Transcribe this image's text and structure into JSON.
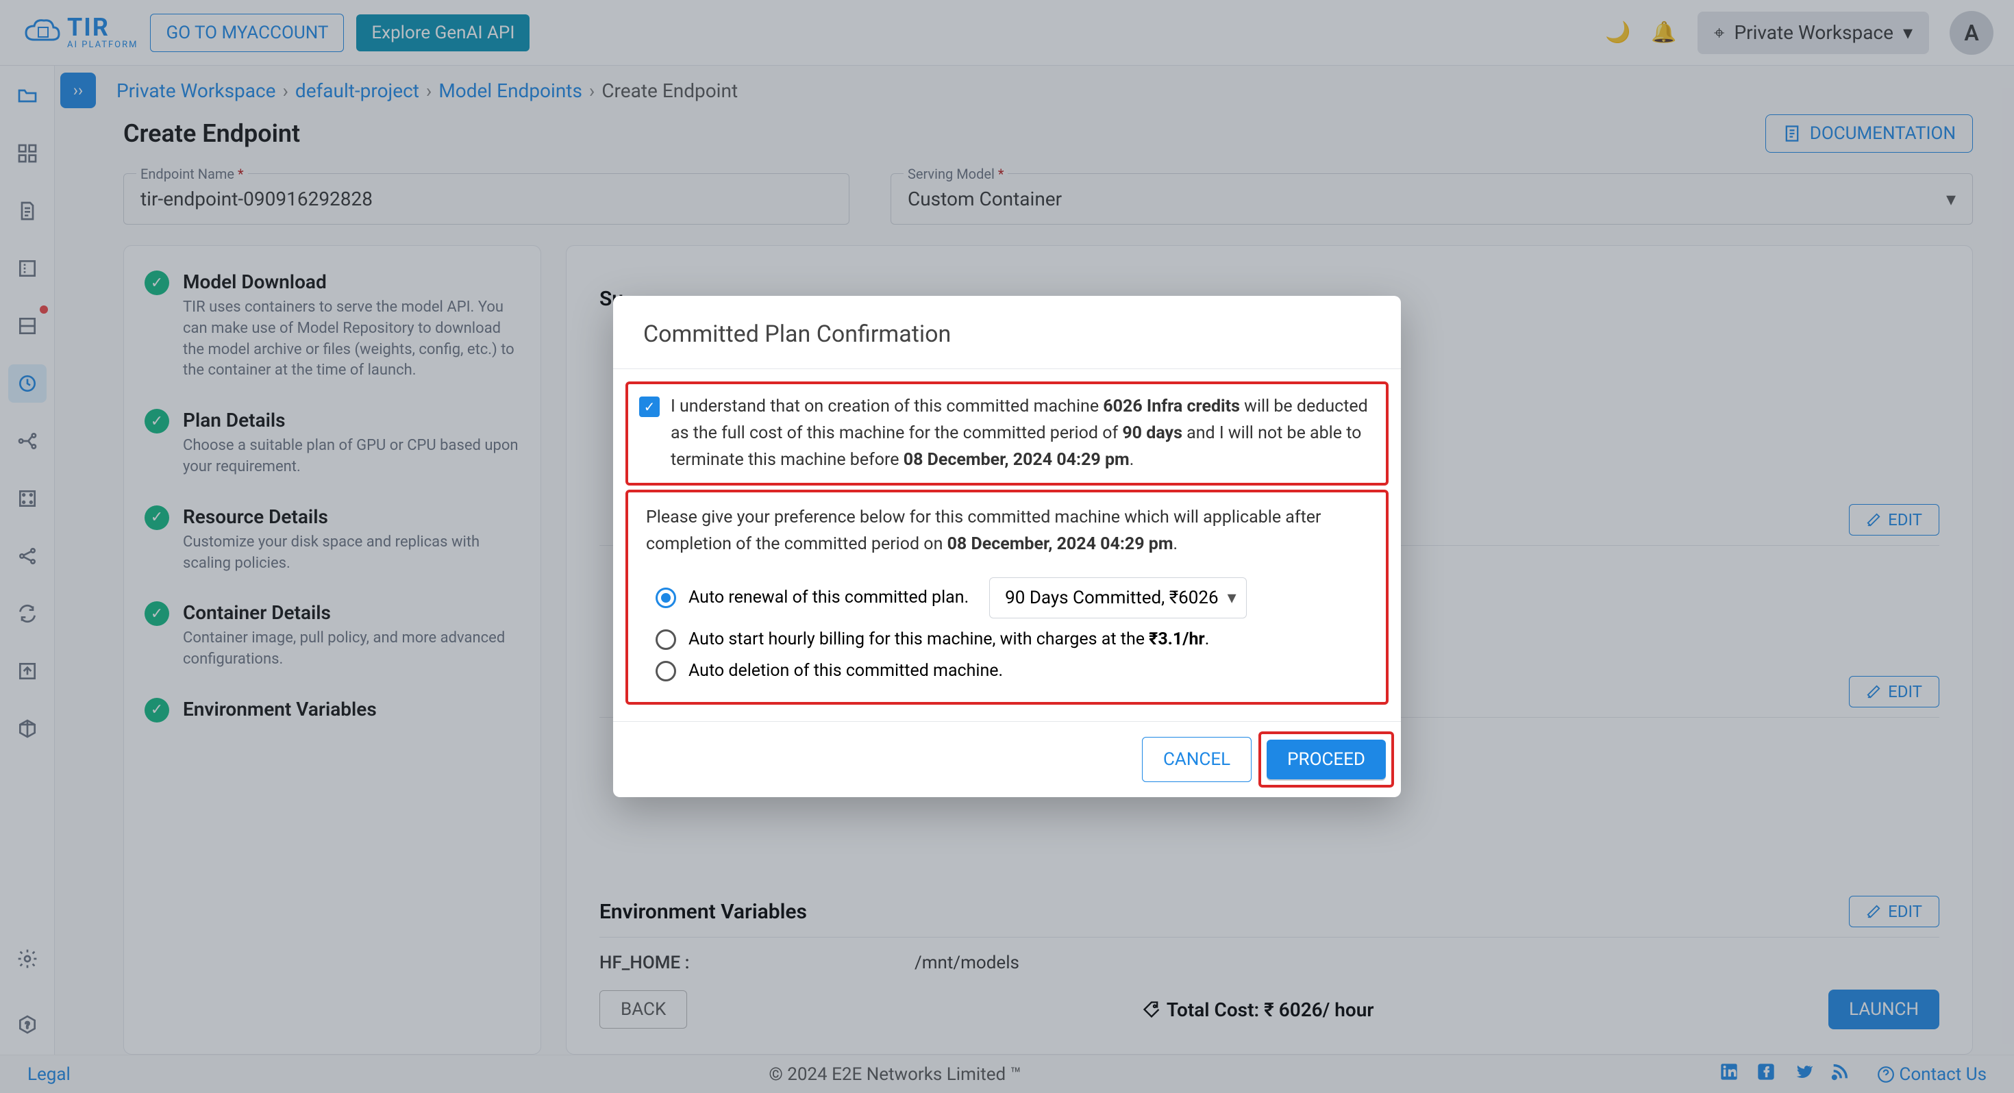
{
  "header": {
    "logo_name": "TIR",
    "logo_tag": "AI PLATFORM",
    "my_account": "GO TO MYACCOUNT",
    "explore": "Explore GenAI API",
    "workspace": "Private Workspace",
    "avatar": "A"
  },
  "breadcrumb": {
    "items": [
      "Private Workspace",
      "default-project",
      "Model Endpoints"
    ],
    "current": "Create Endpoint"
  },
  "page": {
    "title": "Create Endpoint",
    "doc_btn": "DOCUMENTATION",
    "endpoint_label": "Endpoint Name",
    "endpoint_value": "tir-endpoint-090916292828",
    "serving_label": "Serving Model",
    "serving_value": "Custom Container"
  },
  "steps": [
    {
      "title": "Model Download",
      "desc": "TIR uses containers to serve the model API. You can make use of Model Repository to download the model archive or files (weights, config, etc.) to the container at the time of launch."
    },
    {
      "title": "Plan Details",
      "desc": "Choose a suitable plan of GPU or CPU based upon your requirement."
    },
    {
      "title": "Resource Details",
      "desc": "Customize your disk space and replicas with scaling policies."
    },
    {
      "title": "Container Details",
      "desc": "Container image, pull policy, and more advanced configurations."
    },
    {
      "title": "Environment Variables",
      "desc": ""
    }
  ],
  "summary": {
    "title": "Su",
    "env_section": "Environment Variables",
    "edit_label": "EDIT",
    "kv": {
      "key": "HF_HOME :",
      "value": "/mnt/models"
    }
  },
  "bottom": {
    "back": "BACK",
    "cost": "Total Cost: ₹ 6026/ hour",
    "launch": "LAUNCH"
  },
  "footer": {
    "legal": "Legal",
    "copyright": "© 2024 E2E Networks Limited ™",
    "contact": "Contact Us"
  },
  "modal": {
    "title": "Committed Plan Confirmation",
    "consent_prefix": "I understand that on creation of this committed machine ",
    "consent_credits": "6026 Infra credits",
    "consent_mid1": " will be deducted as the full cost of this machine for the committed period of ",
    "consent_days": "90 days",
    "consent_mid2": " and I will not be able to terminate this machine before ",
    "consent_date": "08 December, 2024 04:29 pm",
    "pref_text_a": "Please give your preference below for this committed machine which will applicable after completion of the committed period on ",
    "pref_text_date": "08 December, 2024 04:29 pm",
    "radio_renew": "Auto renewal of this committed plan.",
    "renew_select": "90 Days Committed, ₹6026",
    "radio_hourly_a": "Auto start hourly billing for this machine, with charges at the ",
    "radio_hourly_rate": "₹3.1/hr",
    "radio_delete": "Auto deletion of this committed machine.",
    "cancel": "CANCEL",
    "proceed": "PROCEED"
  }
}
